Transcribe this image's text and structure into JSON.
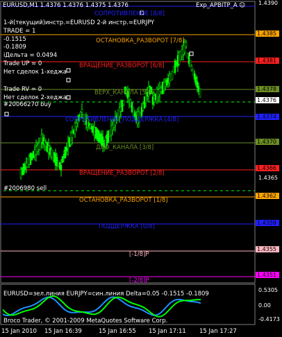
{
  "header": {
    "symbol": "EURUSD,M1  1.4376  1.4376  1.4375  1.4376",
    "expert": "Exp_APBITP_A ☺"
  },
  "info_lines": [
    "1-й(текущий)инстр.=EURUSD 2-й инстр.=EURJPY",
    "TRADE = 1",
    "-0.1515",
    "-0.1809",
    "iДельта = 0.0494",
    "Trade UP = 0",
    "Нет сделок 1-хеджа",
    "Trade RV = 0",
    "Нет сделок 2-хеджа",
    "#20066270 buy",
    "#2006980 sell"
  ],
  "levels": [
    {
      "label": "СОПРОТИВЛЕНИЕ [8/8]",
      "price": "1.4390",
      "color": "#2020ff"
    },
    {
      "label": "ОСТАНОВКА_РАЗВОРОТ [7/8]",
      "price": "1.4385",
      "color": "#ffa500"
    },
    {
      "label": "ВРАЩЕНИЕ_РАЗВОРОТ [6/8]",
      "price": "1.4381",
      "color": "#ff2020"
    },
    {
      "label": "ВЕРХ_КАНАЛА [5/8]",
      "price": "1.4378",
      "color": "#6b8e23"
    },
    {
      "label": "СОПРОТИВЛЕНИЕ_ПОДДЕРЖКА [4/8]",
      "price": "1.4374",
      "color": "#2020ff"
    },
    {
      "label": "ДНО_КАНАЛА [3/8]",
      "price": "1.4370",
      "color": "#6b8e23"
    },
    {
      "label": "ВРАЩЕНИЕ_РАЗВОРОТ [2/8]",
      "price": "1.4366",
      "color": "#ff2020"
    },
    {
      "label": "ОСТАНОВКА_РАЗВОРОТ [1/8]",
      "price": "1.4362",
      "color": "#ffa500"
    },
    {
      "label": "ПОДДЕРЖКА [0/8]",
      "price": "1.4359",
      "color": "#2020ff"
    },
    {
      "label": "[-1/8]P",
      "price": "1.4355",
      "color": "#ffb6c1"
    },
    {
      "label": "[-2/8]P",
      "price": "1.4351",
      "color": "#ff00ff"
    }
  ],
  "current_price": "1.4376",
  "axis_prices": [
    "1.4390",
    "1.4365"
  ],
  "oscillator": {
    "label": "EURUSD=зел.линия EURJPY=син.линия Delta=0.05 -0.1515 -0.1809",
    "ticks": [
      "0.5305",
      "0.00",
      "-0.4173"
    ]
  },
  "copyright": "Broco Trader, © 2001-2009 MetaQuotes Software Corp.",
  "time_labels": [
    "15 Jan 2010",
    "15 Jan 16:39",
    "15 Jan 16:55",
    "15 Jan 17:11",
    "15 Jan 17:27"
  ],
  "colors": {
    "candles": "#00ff00",
    "osc_green": "#00ff00",
    "osc_blue": "#1e90ff"
  }
}
